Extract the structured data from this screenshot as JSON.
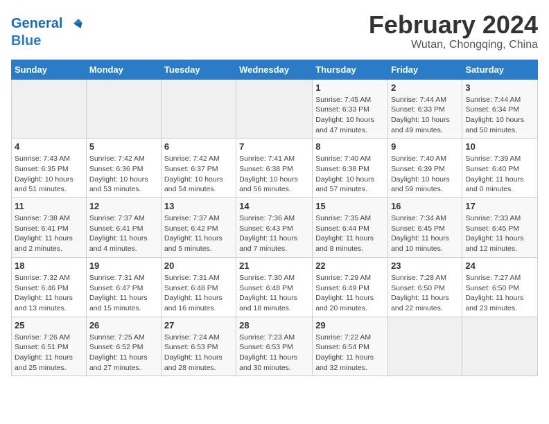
{
  "logo": {
    "line1": "General",
    "line2": "Blue"
  },
  "title": "February 2024",
  "subtitle": "Wutan, Chongqing, China",
  "days_of_week": [
    "Sunday",
    "Monday",
    "Tuesday",
    "Wednesday",
    "Thursday",
    "Friday",
    "Saturday"
  ],
  "weeks": [
    [
      {
        "day": "",
        "info": ""
      },
      {
        "day": "",
        "info": ""
      },
      {
        "day": "",
        "info": ""
      },
      {
        "day": "",
        "info": ""
      },
      {
        "day": "1",
        "info": "Sunrise: 7:45 AM\nSunset: 6:33 PM\nDaylight: 10 hours and 47 minutes."
      },
      {
        "day": "2",
        "info": "Sunrise: 7:44 AM\nSunset: 6:33 PM\nDaylight: 10 hours and 49 minutes."
      },
      {
        "day": "3",
        "info": "Sunrise: 7:44 AM\nSunset: 6:34 PM\nDaylight: 10 hours and 50 minutes."
      }
    ],
    [
      {
        "day": "4",
        "info": "Sunrise: 7:43 AM\nSunset: 6:35 PM\nDaylight: 10 hours and 51 minutes."
      },
      {
        "day": "5",
        "info": "Sunrise: 7:42 AM\nSunset: 6:36 PM\nDaylight: 10 hours and 53 minutes."
      },
      {
        "day": "6",
        "info": "Sunrise: 7:42 AM\nSunset: 6:37 PM\nDaylight: 10 hours and 54 minutes."
      },
      {
        "day": "7",
        "info": "Sunrise: 7:41 AM\nSunset: 6:38 PM\nDaylight: 10 hours and 56 minutes."
      },
      {
        "day": "8",
        "info": "Sunrise: 7:40 AM\nSunset: 6:38 PM\nDaylight: 10 hours and 57 minutes."
      },
      {
        "day": "9",
        "info": "Sunrise: 7:40 AM\nSunset: 6:39 PM\nDaylight: 10 hours and 59 minutes."
      },
      {
        "day": "10",
        "info": "Sunrise: 7:39 AM\nSunset: 6:40 PM\nDaylight: 11 hours and 0 minutes."
      }
    ],
    [
      {
        "day": "11",
        "info": "Sunrise: 7:38 AM\nSunset: 6:41 PM\nDaylight: 11 hours and 2 minutes."
      },
      {
        "day": "12",
        "info": "Sunrise: 7:37 AM\nSunset: 6:41 PM\nDaylight: 11 hours and 4 minutes."
      },
      {
        "day": "13",
        "info": "Sunrise: 7:37 AM\nSunset: 6:42 PM\nDaylight: 11 hours and 5 minutes."
      },
      {
        "day": "14",
        "info": "Sunrise: 7:36 AM\nSunset: 6:43 PM\nDaylight: 11 hours and 7 minutes."
      },
      {
        "day": "15",
        "info": "Sunrise: 7:35 AM\nSunset: 6:44 PM\nDaylight: 11 hours and 8 minutes."
      },
      {
        "day": "16",
        "info": "Sunrise: 7:34 AM\nSunset: 6:45 PM\nDaylight: 11 hours and 10 minutes."
      },
      {
        "day": "17",
        "info": "Sunrise: 7:33 AM\nSunset: 6:45 PM\nDaylight: 11 hours and 12 minutes."
      }
    ],
    [
      {
        "day": "18",
        "info": "Sunrise: 7:32 AM\nSunset: 6:46 PM\nDaylight: 11 hours and 13 minutes."
      },
      {
        "day": "19",
        "info": "Sunrise: 7:31 AM\nSunset: 6:47 PM\nDaylight: 11 hours and 15 minutes."
      },
      {
        "day": "20",
        "info": "Sunrise: 7:31 AM\nSunset: 6:48 PM\nDaylight: 11 hours and 16 minutes."
      },
      {
        "day": "21",
        "info": "Sunrise: 7:30 AM\nSunset: 6:48 PM\nDaylight: 11 hours and 18 minutes."
      },
      {
        "day": "22",
        "info": "Sunrise: 7:29 AM\nSunset: 6:49 PM\nDaylight: 11 hours and 20 minutes."
      },
      {
        "day": "23",
        "info": "Sunrise: 7:28 AM\nSunset: 6:50 PM\nDaylight: 11 hours and 22 minutes."
      },
      {
        "day": "24",
        "info": "Sunrise: 7:27 AM\nSunset: 6:50 PM\nDaylight: 11 hours and 23 minutes."
      }
    ],
    [
      {
        "day": "25",
        "info": "Sunrise: 7:26 AM\nSunset: 6:51 PM\nDaylight: 11 hours and 25 minutes."
      },
      {
        "day": "26",
        "info": "Sunrise: 7:25 AM\nSunset: 6:52 PM\nDaylight: 11 hours and 27 minutes."
      },
      {
        "day": "27",
        "info": "Sunrise: 7:24 AM\nSunset: 6:53 PM\nDaylight: 11 hours and 28 minutes."
      },
      {
        "day": "28",
        "info": "Sunrise: 7:23 AM\nSunset: 6:53 PM\nDaylight: 11 hours and 30 minutes."
      },
      {
        "day": "29",
        "info": "Sunrise: 7:22 AM\nSunset: 6:54 PM\nDaylight: 11 hours and 32 minutes."
      },
      {
        "day": "",
        "info": ""
      },
      {
        "day": "",
        "info": ""
      }
    ]
  ]
}
